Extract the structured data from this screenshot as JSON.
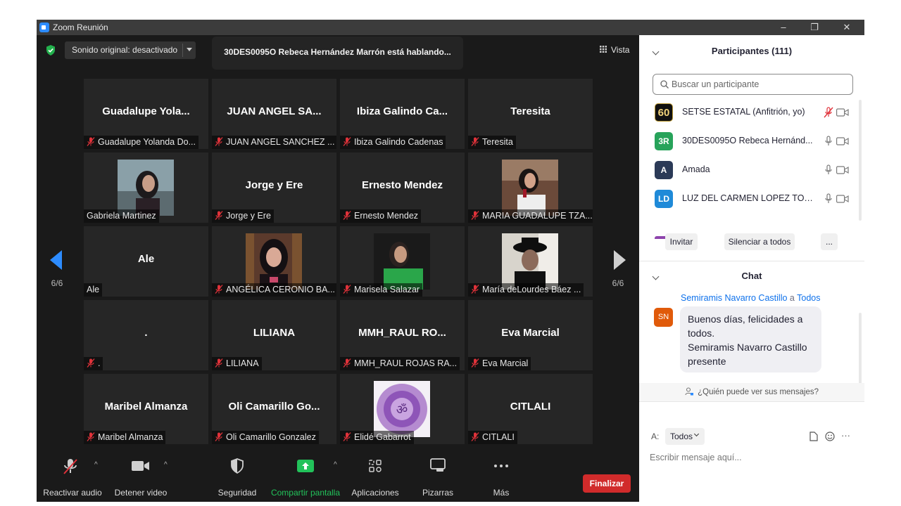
{
  "window": {
    "title": "Zoom Reunión",
    "controls": [
      "–",
      "❐",
      "✕"
    ]
  },
  "meeting": {
    "audio_label": "Sonido original: desactivado",
    "speaking_banner": "30DES0095O  Rebeca Hernández Marrón está hablando...",
    "view_label": "Vista",
    "page_left": "6/6",
    "page_right": "6/6"
  },
  "tiles": [
    {
      "big": "Guadalupe  Yola...",
      "name": "Guadalupe Yolanda Do...",
      "muted": true,
      "photo": null
    },
    {
      "big": "JUAN ANGEL SA...",
      "name": "JUAN ANGEL SANCHEZ ...",
      "muted": true,
      "photo": null
    },
    {
      "big": "Ibiza  Galindo  Ca...",
      "name": "Ibiza Galindo Cadenas",
      "muted": true,
      "photo": null
    },
    {
      "big": "Teresita",
      "name": "Teresita",
      "muted": true,
      "photo": null
    },
    {
      "big": "",
      "name": "Gabriela Martinez",
      "muted": false,
      "photo": "woman-dark-hair"
    },
    {
      "big": "Jorge y Ere",
      "name": "Jorge y Ere",
      "muted": true,
      "photo": null
    },
    {
      "big": "Ernesto Mendez",
      "name": "Ernesto Mendez",
      "muted": true,
      "photo": null
    },
    {
      "big": "",
      "name": "MARIA GUADALUPE TZA...",
      "muted": true,
      "photo": "woman-with-glass"
    },
    {
      "big": "Ale",
      "name": "Ale",
      "muted": false,
      "photo": null
    },
    {
      "big": "",
      "name": "ANGÉLICA CERONIO BA...",
      "muted": true,
      "photo": "woman-bookshelf"
    },
    {
      "big": "",
      "name": "Marisela Salazar",
      "muted": true,
      "photo": "woman-green-shirt"
    },
    {
      "big": "",
      "name": "María deLourdes Báez ...",
      "muted": true,
      "photo": "person-black-hat"
    },
    {
      "big": ".",
      "name": ".",
      "muted": true,
      "photo": null
    },
    {
      "big": "LILIANA",
      "name": "LILIANA",
      "muted": true,
      "photo": null
    },
    {
      "big": "MMH_RAUL  RO...",
      "name": "MMH_RAUL ROJAS RA...",
      "muted": true,
      "photo": null
    },
    {
      "big": "Eva Marcial",
      "name": "Eva Marcial",
      "muted": true,
      "photo": null
    },
    {
      "big": "Maribel Almanza",
      "name": "Maribel Almanza",
      "muted": true,
      "photo": null
    },
    {
      "big": "Oli  Camarillo  Go...",
      "name": "Oli Camarillo Gonzalez",
      "muted": true,
      "photo": null
    },
    {
      "big": "",
      "name": "Elidé Gabarrot",
      "muted": true,
      "photo": "purple-om-mandala"
    },
    {
      "big": "CITLALI",
      "name": "CITLALI",
      "muted": true,
      "photo": null
    }
  ],
  "toolbar": {
    "audio": "Reactivar audio",
    "video": "Detener video",
    "security": "Seguridad",
    "share": "Compartir pantalla",
    "apps": "Aplicaciones",
    "whiteboards": "Pizarras",
    "more": "Más",
    "end": "Finalizar"
  },
  "participants": {
    "header": "Participantes (111)",
    "search_placeholder": "Buscar un participante",
    "list": [
      {
        "initials": "60",
        "name": "SETSE ESTATAL (Anfitrión, yo)",
        "color": "#111111",
        "mic_muted": true
      },
      {
        "initials": "3R",
        "name": "30DES0095O  Rebeca Hernánd...",
        "color": "#27a35a",
        "mic_muted": false
      },
      {
        "initials": "A",
        "name": "Amada",
        "color": "#2b3a57",
        "mic_muted": false
      },
      {
        "initials": "LD",
        "name": "LUZ DEL CARMEN LOPEZ TOBIAS",
        "color": "#1f8ad8",
        "mic_muted": false
      }
    ],
    "invite": "Invitar",
    "mute_all": "Silenciar a todos",
    "more": "..."
  },
  "chat": {
    "header": "Chat",
    "from": "Semiramis Navarro Castillo",
    "to_word": "a",
    "to": "Todos",
    "avatar": "SN",
    "message_lines": [
      "Buenos días, felicidades a",
      "todos.",
      "Semiramis Navarro Castillo",
      "presente"
    ],
    "who_sees": "¿Quién puede ver sus mensajes?",
    "to_label": "A:",
    "recipient": "Todos",
    "input_placeholder": "Escribir mensaje aquí...",
    "more": "···"
  },
  "colors": {
    "accent": "#2d8cff",
    "end_red": "#d12b2b",
    "muted_red": "#e0323a",
    "share_green": "#22c25a"
  }
}
